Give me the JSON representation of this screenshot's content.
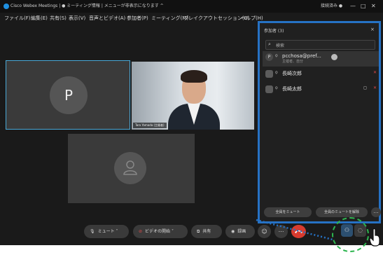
{
  "window": {
    "title": "Cisco Webex Meetings | ● ミーティング情報 | メニューが非表示になります ^",
    "status_right": "接続済み ●",
    "controls": [
      "—",
      "□",
      "✕"
    ]
  },
  "menubar": {
    "items": [
      "ファイル(F)",
      "編集(E)",
      "共有(S)",
      "表示(V)",
      "音声とビデオ(A)",
      "参加者(P)",
      "ミーティング(M)",
      "ブレイクアウトセッション(B)",
      "ヘルプ(H)"
    ]
  },
  "videos": {
    "tile1_initial": "P",
    "tile2_name": "Taro Yamada (主催者)"
  },
  "participants_panel": {
    "title": "参加者 (3)",
    "close": "×",
    "search_placeholder": "検索",
    "participants": [
      {
        "avatar": "P",
        "name": "pcchosa@pref...",
        "role": "主催者、自分"
      },
      {
        "avatar": "",
        "name": "長崎次郎",
        "role": ""
      },
      {
        "avatar": "",
        "name": "長崎太郎",
        "role": ""
      }
    ],
    "mute_all": "全員をミュート",
    "unmute_all": "全員のミュートを解除",
    "more": "…"
  },
  "controls": {
    "mute": "ミュート",
    "video": "ビデオの開始",
    "share": "共有",
    "record": "録画"
  },
  "colors": {
    "panel_highlight": "#2672c5",
    "end_button": "#d83b2f",
    "callout": "#2db54f"
  }
}
